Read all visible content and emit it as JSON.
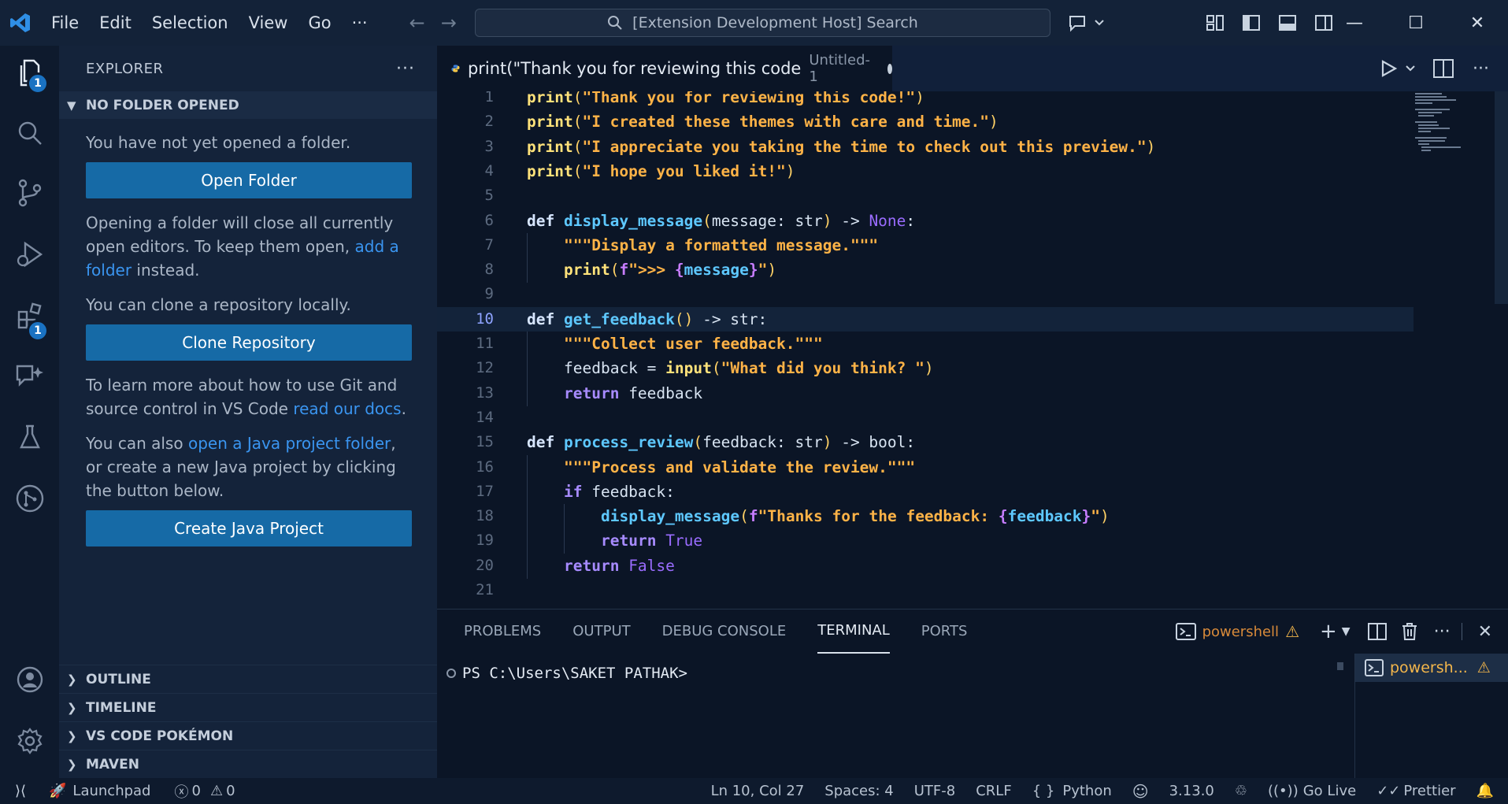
{
  "titlebar": {
    "menus": [
      "File",
      "Edit",
      "Selection",
      "View",
      "Go",
      "···"
    ],
    "search_text": "[Extension Development Host] Search"
  },
  "activity": {
    "explorer_badge": "1",
    "extensions_badge": "1"
  },
  "sidebar": {
    "title": "EXPLORER",
    "section": "NO FOLDER OPENED",
    "p1": "You have not yet opened a folder.",
    "open_folder": "Open Folder",
    "p2_pre": "Opening a folder will close all currently open editors. To keep them open,",
    "p2_link": "add a folder",
    "p2_post": "instead.",
    "p3": "You can clone a repository locally.",
    "clone": "Clone Repository",
    "p4_pre": "To learn more about how to use Git and source control in VS Code",
    "p4_link": "read our docs",
    "p4_post": ".",
    "p5_pre": "You can also",
    "p5_link": "open a Java project folder",
    "p5_post": ", or create a new Java project by clicking the button below.",
    "create_java": "Create Java Project",
    "bottom": [
      "OUTLINE",
      "TIMELINE",
      "VS CODE POKÉMON",
      "MAVEN"
    ]
  },
  "tab": {
    "name": "print(\"Thank you for reviewing this code",
    "desc": "Untitled-1"
  },
  "editor": {
    "current_line": 10,
    "lines": [
      {
        "n": "1",
        "indent": 0,
        "tokens": [
          [
            "kw",
            "print"
          ],
          [
            "punc",
            "("
          ],
          [
            "str",
            "\"Thank you for reviewing this code!\""
          ],
          [
            "punc",
            ")"
          ]
        ]
      },
      {
        "n": "2",
        "indent": 0,
        "tokens": [
          [
            "kw",
            "print"
          ],
          [
            "punc",
            "("
          ],
          [
            "str",
            "\"I created these themes with care and time.\""
          ],
          [
            "punc",
            ")"
          ]
        ]
      },
      {
        "n": "3",
        "indent": 0,
        "tokens": [
          [
            "kw",
            "print"
          ],
          [
            "punc",
            "("
          ],
          [
            "str",
            "\"I appreciate you taking the time to check out this preview.\""
          ],
          [
            "punc",
            ")"
          ]
        ]
      },
      {
        "n": "4",
        "indent": 0,
        "tokens": [
          [
            "kw",
            "print"
          ],
          [
            "punc",
            "("
          ],
          [
            "str",
            "\"I hope you liked it!\""
          ],
          [
            "punc",
            ")"
          ]
        ]
      },
      {
        "n": "5",
        "indent": 0,
        "tokens": []
      },
      {
        "n": "6",
        "indent": 0,
        "tokens": [
          [
            "def",
            "def "
          ],
          [
            "fn",
            "display_message"
          ],
          [
            "punc",
            "("
          ],
          [
            "plain",
            "message: str"
          ],
          [
            "punc",
            ")"
          ],
          [
            "plain",
            " -> "
          ],
          [
            "none",
            "None"
          ],
          [
            "plain",
            ":"
          ]
        ]
      },
      {
        "n": "7",
        "indent": 1,
        "tokens": [
          [
            "str",
            "\"\"\"Display a formatted message.\"\"\""
          ]
        ]
      },
      {
        "n": "8",
        "indent": 1,
        "tokens": [
          [
            "kw",
            "print"
          ],
          [
            "punc",
            "("
          ],
          [
            "fpre",
            "f"
          ],
          [
            "str",
            "\">>> "
          ],
          [
            "brace",
            "{"
          ],
          [
            "fn",
            "message"
          ],
          [
            "brace",
            "}"
          ],
          [
            "str",
            "\""
          ],
          [
            "punc",
            ")"
          ]
        ]
      },
      {
        "n": "9",
        "indent": 0,
        "tokens": []
      },
      {
        "n": "10",
        "indent": 0,
        "tokens": [
          [
            "def",
            "def "
          ],
          [
            "fn",
            "get_feedback"
          ],
          [
            "punc",
            "()"
          ],
          [
            "plain",
            " -> str:"
          ]
        ]
      },
      {
        "n": "11",
        "indent": 1,
        "tokens": [
          [
            "str",
            "\"\"\"Collect user feedback.\"\"\""
          ]
        ]
      },
      {
        "n": "12",
        "indent": 1,
        "tokens": [
          [
            "plain",
            "feedback = "
          ],
          [
            "kw",
            "input"
          ],
          [
            "punc",
            "("
          ],
          [
            "str",
            "\"What did you think? \""
          ],
          [
            "punc",
            ")"
          ]
        ]
      },
      {
        "n": "13",
        "indent": 1,
        "tokens": [
          [
            "ret",
            "return"
          ],
          [
            "plain",
            " feedback"
          ]
        ]
      },
      {
        "n": "14",
        "indent": 0,
        "tokens": []
      },
      {
        "n": "15",
        "indent": 0,
        "tokens": [
          [
            "def",
            "def "
          ],
          [
            "fn",
            "process_review"
          ],
          [
            "punc",
            "("
          ],
          [
            "plain",
            "feedback: str"
          ],
          [
            "punc",
            ")"
          ],
          [
            "plain",
            " -> bool:"
          ]
        ]
      },
      {
        "n": "16",
        "indent": 1,
        "tokens": [
          [
            "str",
            "\"\"\"Process and validate the review.\"\"\""
          ]
        ]
      },
      {
        "n": "17",
        "indent": 1,
        "tokens": [
          [
            "ret",
            "if"
          ],
          [
            "plain",
            " feedback:"
          ]
        ]
      },
      {
        "n": "18",
        "indent": 2,
        "tokens": [
          [
            "fn",
            "display_message"
          ],
          [
            "punc",
            "("
          ],
          [
            "fpre",
            "f"
          ],
          [
            "str",
            "\"Thanks for the feedback: "
          ],
          [
            "brace",
            "{"
          ],
          [
            "fn",
            "feedback"
          ],
          [
            "brace",
            "}"
          ],
          [
            "str",
            "\""
          ],
          [
            "punc",
            ")"
          ]
        ]
      },
      {
        "n": "19",
        "indent": 2,
        "tokens": [
          [
            "ret",
            "return"
          ],
          [
            "none",
            " True"
          ]
        ]
      },
      {
        "n": "20",
        "indent": 1,
        "tokens": [
          [
            "ret",
            "return"
          ],
          [
            "none",
            " False"
          ]
        ]
      },
      {
        "n": "21",
        "indent": 0,
        "tokens": []
      }
    ]
  },
  "panel": {
    "tabs": [
      "PROBLEMS",
      "OUTPUT",
      "DEBUG CONSOLE",
      "TERMINAL",
      "PORTS"
    ],
    "active_tab": "TERMINAL",
    "shell": "powershell",
    "prompt": "PS C:\\Users\\SAKET PATHAK>",
    "terminal_item": "powersh..."
  },
  "statusbar": {
    "launchpad": "Launchpad",
    "errors": "0",
    "warnings": "0",
    "position": "Ln 10, Col 27",
    "spaces": "Spaces: 4",
    "encoding": "UTF-8",
    "eol": "CRLF",
    "language": "Python",
    "version": "3.13.0",
    "golive": "Go Live",
    "prettier": "Prettier"
  },
  "colors": {
    "accent": "#1a72c2",
    "button": "#166aa6",
    "link": "#3a95f0",
    "warning": "#f3b64b"
  }
}
